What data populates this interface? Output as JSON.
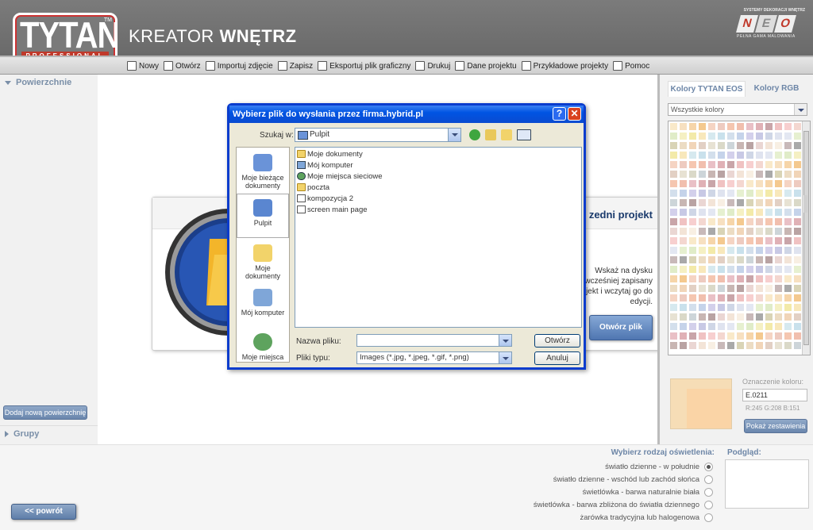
{
  "header": {
    "logo_text": "TYTAN",
    "logo_sub": "PROFESSIONAL",
    "logo_tm": "TM",
    "app_title_light": "KREATOR ",
    "app_title_bold": "WNĘTRZ",
    "neo_top": "SYSTEMY DEKORACJI WNĘTRZ",
    "neo_letters": [
      "N",
      "E",
      "O"
    ],
    "neo_bottom": "PEŁNA GAMA MALOWANIA"
  },
  "toolbar": {
    "items": [
      {
        "label": "Nowy",
        "icon": "new-icon"
      },
      {
        "label": "Otwórz",
        "icon": "open-icon"
      },
      {
        "label": "Importuj zdjęcie",
        "icon": "import-photo-icon"
      },
      {
        "label": "Zapisz",
        "icon": "save-icon"
      },
      {
        "label": "Eksportuj plik graficzny",
        "icon": "export-icon"
      },
      {
        "label": "Drukuj",
        "icon": "print-icon"
      },
      {
        "label": "Dane projektu",
        "icon": "project-data-icon"
      },
      {
        "label": "Przykładowe projekty",
        "icon": "sample-projects-icon"
      },
      {
        "label": "Pomoc",
        "icon": "help-icon"
      }
    ]
  },
  "left_panel": {
    "surfaces_label": "Powierzchnie",
    "add_surface_label": "Dodaj nową powierzchnię",
    "groups_label": "Grupy"
  },
  "project_card": {
    "title": "zedni projekt",
    "description": "Wskaż na dysku wcześniej zapisany projekt i wczytaj go do edycji.",
    "open_button": "Otwórz plik"
  },
  "dialog": {
    "title": "Wybierz plik do wysłania przez firma.hybrid.pl",
    "help_label": "?",
    "close_label": "✕",
    "lookin_label": "Szukaj w:",
    "lookin_value": "Pulpit",
    "places": [
      {
        "label": "Moje bieżące dokumenty",
        "color": "#6a93d8"
      },
      {
        "label": "Pulpit",
        "color": "#5a86d0"
      },
      {
        "label": "Moje dokumenty",
        "color": "#f2d36a"
      },
      {
        "label": "Mój komputer",
        "color": "#7fa6d8"
      },
      {
        "label": "Moje miejsca",
        "color": "#5ea35e"
      }
    ],
    "files": [
      {
        "name": "Moje dokumenty",
        "kind": "folder"
      },
      {
        "name": "Mój komputer",
        "kind": "pc"
      },
      {
        "name": "Moje miejsca sieciowe",
        "kind": "net"
      },
      {
        "name": "poczta",
        "kind": "folder"
      },
      {
        "name": "kompozycja 2",
        "kind": "doc"
      },
      {
        "name": "screen main page",
        "kind": "doc"
      }
    ],
    "filename_label": "Nazwa pliku:",
    "filename_value": "",
    "filetype_label": "Pliki typu:",
    "filetype_value": "Images (*.jpg, *.jpeg, *.gif, *.png)",
    "open_button": "Otwórz",
    "cancel_button": "Anuluj"
  },
  "right_panel": {
    "tab_eos": "Kolory TYTAN EOS",
    "tab_rgb": "Kolory RGB",
    "filter_value": "Wszystkie kolory",
    "swatch_colors": [
      "#f9e9c9",
      "#f7e0c0",
      "#f6d5a9",
      "#f4c98f",
      "#f5d4c3",
      "#eecbc0",
      "#f5c6b0",
      "#f1bfae",
      "#e9c0c6",
      "#e0b1b6",
      "#c9a5a9",
      "#f0c2c2",
      "#f7cfcf",
      "#f4d7d0",
      "#e6f0d0",
      "#e0ecc8",
      "#f5f0c3",
      "#f3eaa9",
      "#f8e8bb",
      "#d6e9ef",
      "#c9e1ec",
      "#d3dfec",
      "#c5d3ea",
      "#d3d0eb",
      "#c8c9e5",
      "#cfd6e6",
      "#dfe3ef",
      "#e3e7f2"
    ],
    "code_label": "Oznaczenie koloru:",
    "code_value": "E.0211",
    "rgb_text": "R:245 G:208 B:151",
    "show_button": "Pokaż zestawienia"
  },
  "bottom": {
    "lighting_title": "Wybierz rodzaj oświetlenia:",
    "lighting_options": [
      {
        "label": "światło dzienne - w południe",
        "selected": true
      },
      {
        "label": "światło dzienne - wschód lub zachód słońca",
        "selected": false
      },
      {
        "label": "świetlówka - barwa naturalnie biała",
        "selected": false
      },
      {
        "label": "świetlówka - barwa zbliżona do światła dziennego",
        "selected": false
      },
      {
        "label": "żarówka tradycyjna lub halogenowa",
        "selected": false
      }
    ],
    "preview_title": "Podgląd:",
    "back_button": "<< powrót"
  }
}
